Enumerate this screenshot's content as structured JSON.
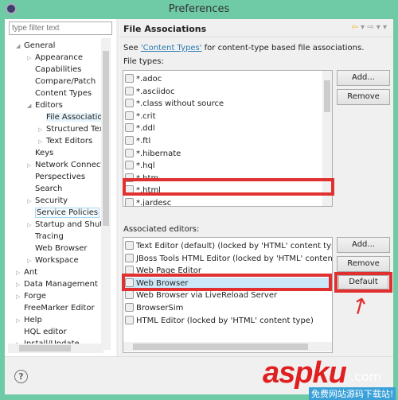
{
  "window": {
    "title": "Preferences"
  },
  "filter": {
    "placeholder": "type filter text"
  },
  "tree": [
    {
      "label": "General",
      "level": 0,
      "exp": "open"
    },
    {
      "label": "Appearance",
      "level": 1,
      "exp": "closed"
    },
    {
      "label": "Capabilities",
      "level": 1
    },
    {
      "label": "Compare/Patch",
      "level": 1
    },
    {
      "label": "Content Types",
      "level": 1
    },
    {
      "label": "Editors",
      "level": 1,
      "exp": "open"
    },
    {
      "label": "File Associations",
      "level": 2,
      "selected": true
    },
    {
      "label": "Structured Text",
      "level": 2,
      "exp": "closed"
    },
    {
      "label": "Text Editors",
      "level": 2,
      "exp": "closed"
    },
    {
      "label": "Keys",
      "level": 1
    },
    {
      "label": "Network Connections",
      "level": 1,
      "exp": "closed"
    },
    {
      "label": "Perspectives",
      "level": 1
    },
    {
      "label": "Search",
      "level": 1
    },
    {
      "label": "Security",
      "level": 1,
      "exp": "closed"
    },
    {
      "label": "Service Policies",
      "level": 1,
      "focused": true
    },
    {
      "label": "Startup and Shutdown",
      "level": 1,
      "exp": "closed"
    },
    {
      "label": "Tracing",
      "level": 1
    },
    {
      "label": "Web Browser",
      "level": 1
    },
    {
      "label": "Workspace",
      "level": 1,
      "exp": "closed"
    },
    {
      "label": "Ant",
      "level": 0,
      "exp": "closed"
    },
    {
      "label": "Data Management",
      "level": 0,
      "exp": "closed"
    },
    {
      "label": "Forge",
      "level": 0,
      "exp": "closed"
    },
    {
      "label": "FreeMarker Editor",
      "level": 0
    },
    {
      "label": "Help",
      "level": 0,
      "exp": "closed"
    },
    {
      "label": "HQL editor",
      "level": 0
    },
    {
      "label": "Install/Update",
      "level": 0,
      "exp": "closed"
    }
  ],
  "page": {
    "title": "File Associations",
    "desc_pre": "See ",
    "desc_link": "'Content Types'",
    "desc_post": " for content-type based file associations.",
    "file_types_label": "File types:",
    "file_types": [
      "*.adoc",
      "*.asciidoc",
      "*.class without source",
      "*.crit",
      "*.ddl",
      "*.ftl",
      "*.hibernate",
      "*.hql",
      "*.htm",
      "*.html",
      "*.jardesc"
    ],
    "selected_file_type": "*.html",
    "editors_label": "Associated editors:",
    "editors": [
      "Text Editor (default) (locked by 'HTML' content type)",
      "JBoss Tools HTML Editor (locked by 'HTML' content type)",
      "Web Page Editor",
      "Web Browser",
      "Web Browser via LiveReload Server",
      "BrowserSim",
      "HTML Editor (locked by 'HTML' content type)"
    ],
    "selected_editor": "Web Browser",
    "buttons": {
      "add": "Add...",
      "remove": "Remove",
      "add2": "Add...",
      "remove2": "Remove",
      "default": "Default"
    }
  },
  "help": "?",
  "watermark": {
    "main": "aspku",
    "suffix": ".com",
    "sub": "免费网站源码下载站!"
  },
  "colors": {
    "frame": "#6fcaa6",
    "highlight": "#e03030",
    "selection": "#cce8f8",
    "link": "#2a7ab0"
  }
}
